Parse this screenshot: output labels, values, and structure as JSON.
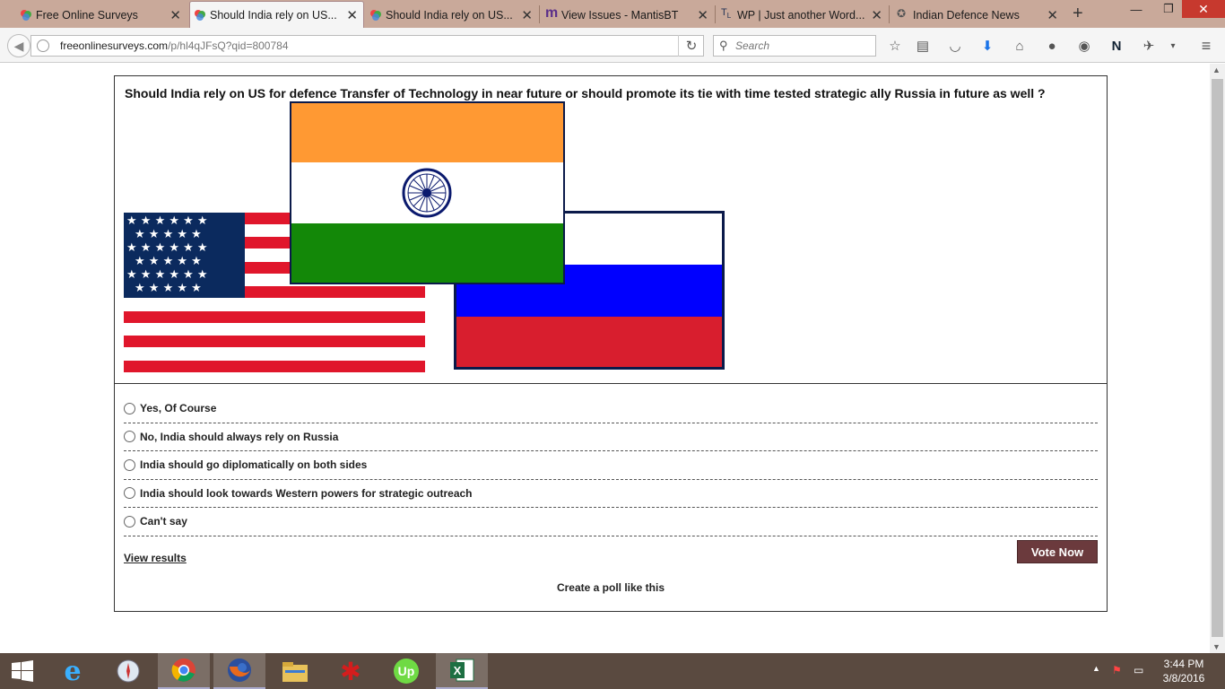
{
  "browser": {
    "tabs": [
      {
        "label": "Free Online Surveys",
        "active": false
      },
      {
        "label": "Should India rely on US...",
        "active": true
      },
      {
        "label": "Should India rely on US...",
        "active": false
      },
      {
        "label": "View Issues - MantisBT",
        "active": false
      },
      {
        "label": "WP | Just another Word...",
        "active": false
      },
      {
        "label": "Indian Defence News",
        "active": false
      }
    ],
    "new_tab": "+",
    "url_domain": "freeonlinesurveys.com",
    "url_path": "/p/hl4qJFsQ?qid=800784",
    "search_placeholder": "Search"
  },
  "poll": {
    "question": "Should India rely on US for defence Transfer of Technology in near future or should promote its tie with time tested strategic ally Russia in future as well ?",
    "options": [
      "Yes, Of Course",
      "No, India should always rely on Russia",
      "India should go diplomatically on both sides",
      "India should look towards Western powers for strategic outreach",
      "Can't say"
    ],
    "view_results": "View results",
    "vote_button": "Vote Now",
    "create_link": "Create a poll like this"
  },
  "taskbar": {
    "time": "3:44 PM",
    "date": "3/8/2016"
  },
  "colors": {
    "vote_button": "#6b3a3d",
    "tabbar": "#c9a99a",
    "india_saffron": "#ff9933",
    "india_green": "#138808",
    "russia_blue": "#0000ff",
    "russia_red": "#d81e2e",
    "us_red": "#e0162b",
    "us_blue": "#002868"
  }
}
